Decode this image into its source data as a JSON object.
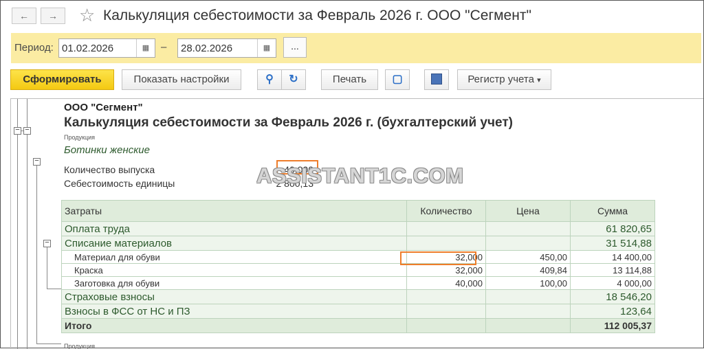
{
  "window": {
    "title": "Калькуляция себестоимости за Февраль 2026 г. ООО \"Сегмент\"",
    "nav_back": "←",
    "nav_forward": "→",
    "star": "☆"
  },
  "period": {
    "label": "Период:",
    "from": "01.02.2026",
    "to": "28.02.2026",
    "separator": "–",
    "more_label": "..."
  },
  "toolbar": {
    "generate_label": "Сформировать",
    "settings_label": "Показать настройки",
    "print_label": "Печать",
    "register_label": "Регистр учета",
    "register_arrow": "▾"
  },
  "report": {
    "org": "ООО \"Сегмент\"",
    "title": "Калькуляция себестоимости за Февраль 2026 г. (бухгалтерский учет)",
    "product_caption": "Продукция",
    "product": "Ботинки женские",
    "output_label": "Количество выпуска",
    "output_value": "40,000",
    "unit_cost_label": "Себестоимость единицы",
    "unit_cost_value": "2 800,13",
    "watermark": "ASSISTANT1C.COM",
    "bottom_caption": "Продукция",
    "columns": {
      "costs": "Затраты",
      "quantity": "Количество",
      "price": "Цена",
      "amount": "Сумма"
    },
    "rows": {
      "labor": {
        "label": "Оплата труда",
        "amount": "61 820,65"
      },
      "materials": {
        "label": "Списание материалов",
        "amount": "31 514,88"
      },
      "m1": {
        "label": "Материал для обуви",
        "qty": "32,000",
        "price": "450,00",
        "amount": "14 400,00"
      },
      "m2": {
        "label": "Краска",
        "qty": "32,000",
        "price": "409,84",
        "amount": "13 114,88"
      },
      "m3": {
        "label": "Заготовка для обуви",
        "qty": "40,000",
        "price": "100,00",
        "amount": "4 000,00"
      },
      "insurance": {
        "label": "Страховые взносы",
        "amount": "18 546,20"
      },
      "fss": {
        "label": "Взносы в ФСС от НС и ПЗ",
        "amount": "123,64"
      },
      "total": {
        "label": "Итого",
        "amount": "112 005,37"
      }
    }
  }
}
